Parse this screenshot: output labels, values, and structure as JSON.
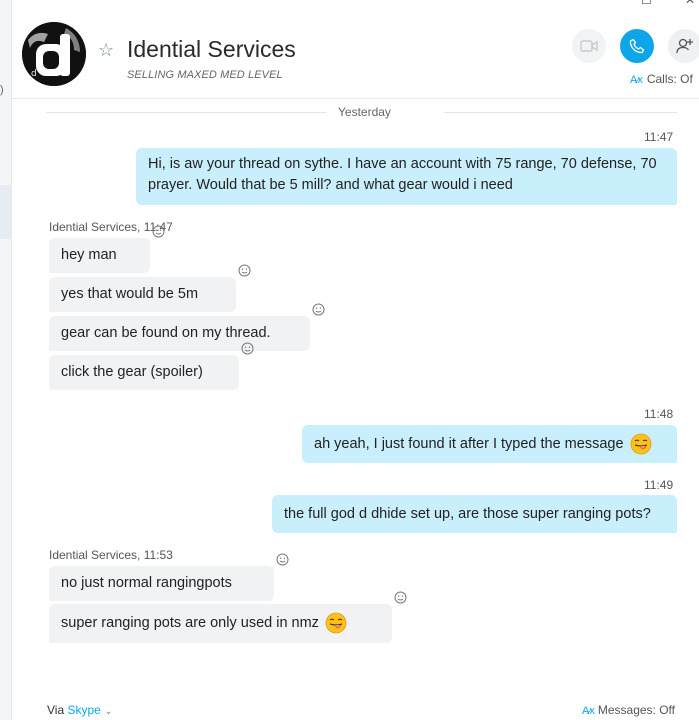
{
  "contact": {
    "name": "Idential Services",
    "mood": "SELLING MAXED MED LEVEL",
    "avatar_letter": "d"
  },
  "window": {
    "minimize": "☐",
    "close": "✕"
  },
  "header": {
    "calls_status": "Calls: Of"
  },
  "conversation": {
    "day_label": "Yesterday",
    "msg1": {
      "time": "11:47",
      "text": "Hi, is aw your thread on sythe. I have an account with 75 range, 70 defense, 70 prayer. Would that be 5 mill? and what gear would i need"
    },
    "group1": {
      "sender": "Idential Services, 11:47",
      "messages": [
        "hey man",
        "yes that would be 5m",
        "gear can be found on my thread.",
        "click the gear (spoiler)"
      ]
    },
    "msg2": {
      "time": "11:48",
      "text": "ah yeah, I just found it after I typed the message"
    },
    "msg3": {
      "time": "11:49",
      "text": "the full god d dhide set up, are those super ranging pots?"
    },
    "group2": {
      "sender": "Idential Services, 11:53",
      "messages": [
        "no just normal rangingpots",
        "super ranging pots are only used in nmz"
      ]
    }
  },
  "footer": {
    "via_label": "Via",
    "via_app": "Skype",
    "messages_status": "Messages: Off"
  },
  "colors": {
    "accent": "#0ea5e9",
    "outgoing_bubble": "#c9eefc",
    "incoming_bubble": "#f1f2f4"
  }
}
